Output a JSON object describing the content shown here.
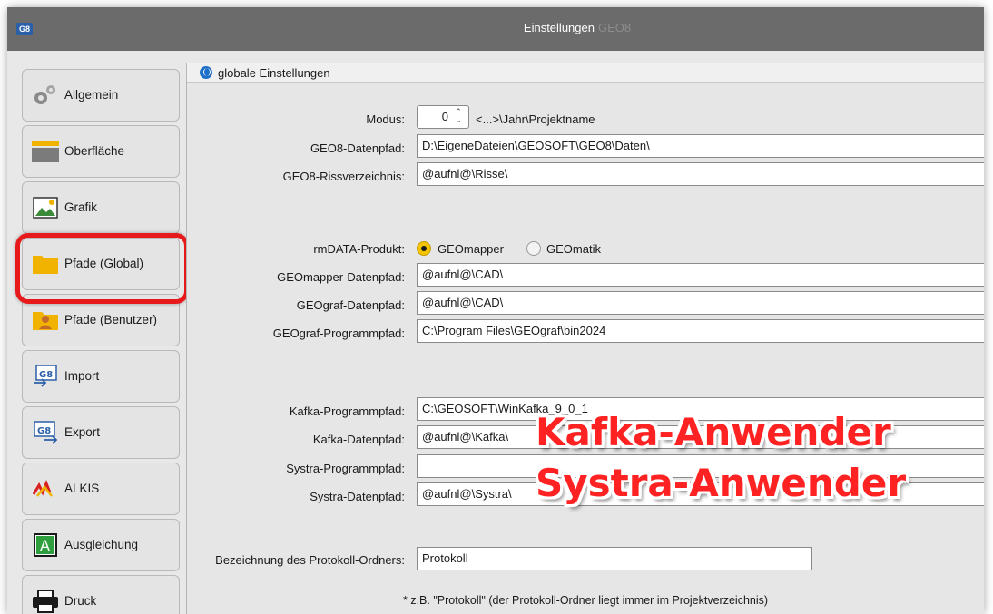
{
  "window": {
    "badge": "G8",
    "title": "Einstellungen",
    "title_suffix": "GEO8"
  },
  "sidebar": {
    "items": [
      {
        "label": "Allgemein",
        "icon": "gears-icon"
      },
      {
        "label": "Oberfläche",
        "icon": "window-icon"
      },
      {
        "label": "Grafik",
        "icon": "image-icon"
      },
      {
        "label": "Pfade (Global)",
        "icon": "folder-icon"
      },
      {
        "label": "Pfade (Benutzer)",
        "icon": "user-folder-icon"
      },
      {
        "label": "Import",
        "icon": "g8-import-icon"
      },
      {
        "label": "Export",
        "icon": "g8-export-icon"
      },
      {
        "label": "ALKIS",
        "icon": "alkis-icon"
      },
      {
        "label": "Ausgleichung",
        "icon": "a-box-icon"
      },
      {
        "label": "Druck",
        "icon": "printer-icon"
      }
    ],
    "highlighted_item": "Pfade (Global)"
  },
  "panel": {
    "header": "globale Einstellungen",
    "modus": {
      "label": "Modus:",
      "value": "0",
      "hint": "<...>\\Jahr\\Projektname"
    },
    "geo8_datenpfad": {
      "label": "GEO8-Datenpfad:",
      "value": "D:\\EigeneDateien\\GEOSOFT\\GEO8\\Daten\\"
    },
    "geo8_riss": {
      "label": "GEO8-Rissverzeichnis:",
      "value": "@aufnl@\\Risse\\"
    },
    "rmdata": {
      "label": "rmDATA-Produkt:",
      "option1": "GEOmapper",
      "option2": "GEOmatik",
      "selected": "GEOmapper"
    },
    "geomapper_daten": {
      "label": "GEOmapper-Datenpfad:",
      "value": "@aufnl@\\CAD\\"
    },
    "geograf_daten": {
      "label": "GEOgraf-Datenpfad:",
      "value": "@aufnl@\\CAD\\"
    },
    "geograf_prog": {
      "label": "GEOgraf-Programmpfad:",
      "value": "C:\\Program Files\\GEOgraf\\bin2024"
    },
    "kafka_prog": {
      "label": "Kafka-Programmpfad:",
      "value": "C:\\GEOSOFT\\WinKafka_9_0_1"
    },
    "kafka_daten": {
      "label": "Kafka-Datenpfad:",
      "value": "@aufnl@\\Kafka\\"
    },
    "systra_prog": {
      "label": "Systra-Programmpfad:",
      "value": ""
    },
    "systra_daten": {
      "label": "Systra-Datenpfad:",
      "value": "@aufnl@\\Systra\\"
    },
    "protokoll": {
      "label": "Bezeichnung des Protokoll-Ordners:",
      "value": "Protokoll"
    },
    "footnote": "* z.B. \"Protokoll\" (der Protokoll-Ordner liegt immer im Projektverzeichnis)"
  },
  "overlay": {
    "line1": "Kafka-Anwender",
    "line2": "Systra-Anwender",
    "color": "#ff2222"
  }
}
